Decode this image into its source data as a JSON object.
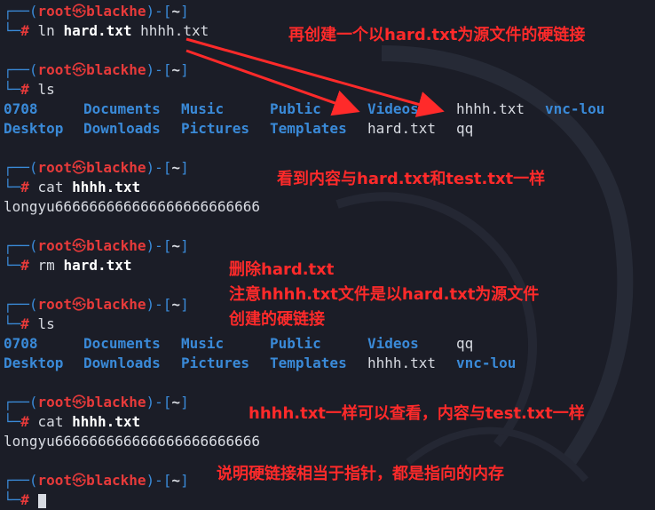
{
  "prompt": {
    "frame_top": "┌──(",
    "user": "root",
    "skull": "㉿",
    "host": "blackhe",
    "mid": ")-[",
    "cwd": "~",
    "end": "]",
    "frame_bottom": "└─",
    "symbol": "#"
  },
  "blocks": [
    {
      "cmd": "ln",
      "arg1": "hard.txt",
      "arg2": "hhhh.txt"
    },
    {
      "cmd": "ls"
    },
    {
      "cmd": "cat",
      "arg1": "hhhh.txt"
    },
    {
      "cmd": "rm",
      "arg1": "hard.txt"
    },
    {
      "cmd": "ls"
    },
    {
      "cmd": "cat",
      "arg1": "hhhh.txt"
    },
    {
      "cmd": ""
    }
  ],
  "ls1": {
    "row1": [
      "0708",
      "Documents",
      "Music",
      "Public",
      "Videos",
      "hhhh.txt",
      "vnc-lou"
    ],
    "row2": [
      "Desktop",
      "Downloads",
      "Pictures",
      "Templates",
      "hard.txt",
      "qq"
    ]
  },
  "ls2": {
    "row1": [
      "0708",
      "Documents",
      "Music",
      "Public",
      "Videos",
      "qq"
    ],
    "row2": [
      "Desktop",
      "Downloads",
      "Pictures",
      "Templates",
      "hhhh.txt",
      "vnc-lou"
    ]
  },
  "cat_output": "longyu666666666666666666666666",
  "annotations": {
    "a1": "再创建一个以hard.txt为源文件的硬链接",
    "a2": "看到内容与hard.txt和test.txt一样",
    "a3": "删除hard.txt\n注意hhhh.txt文件是以hard.txt为源文件\n创建的硬链接",
    "a4": "hhhh.txt一样可以查看，内容与test.txt一样",
    "a5": "说明硬链接相当于指针，都是指向的内存"
  },
  "colors": {
    "background": "#1b1d27",
    "directory": "#3a8ad8",
    "prompt_red": "#e63a3a",
    "annotation": "#ff2a2a"
  }
}
